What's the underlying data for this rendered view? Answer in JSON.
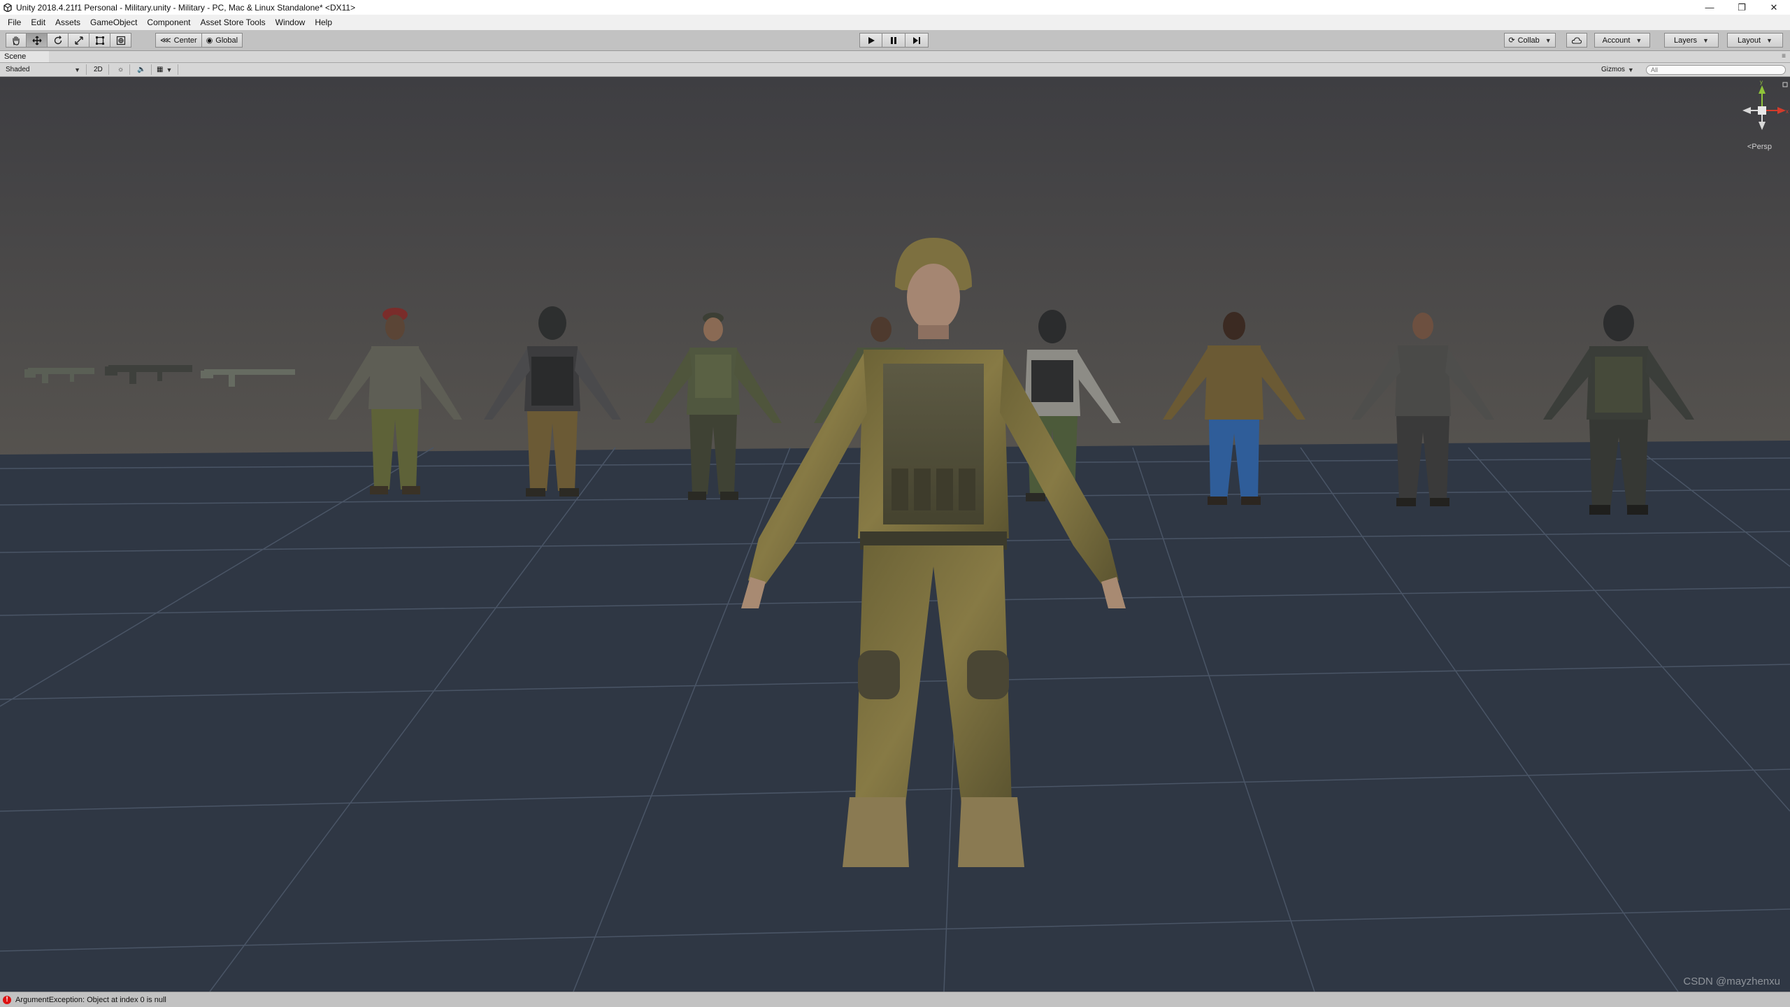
{
  "window": {
    "title": "Unity 2018.4.21f1 Personal - Military.unity - Military - PC, Mac & Linux Standalone* <DX11>",
    "controls": [
      "minimize-icon",
      "restore-icon",
      "close-icon"
    ]
  },
  "menu": {
    "items": [
      "File",
      "Edit",
      "Assets",
      "GameObject",
      "Component",
      "Asset Store Tools",
      "Window",
      "Help"
    ]
  },
  "toolbar": {
    "tools": [
      "hand-tool-icon",
      "move-tool-icon",
      "rotate-tool-icon",
      "scale-tool-icon",
      "rect-tool-icon",
      "transform-tool-icon"
    ],
    "pivot_center": "Center",
    "pivot_global": "Global",
    "play_controls": [
      "play-icon",
      "pause-icon",
      "step-icon"
    ],
    "collab": "Collab",
    "account": "Account",
    "layers": "Layers",
    "layout": "Layout"
  },
  "scene": {
    "tab_label": "Scene",
    "shading_mode": "Shaded",
    "mode_2d": "2D",
    "gizmos": "Gizmos",
    "search_placeholder": "All",
    "projection": "Persp",
    "watermark": "CSDN @mayzhenxu",
    "colors": {
      "skybox": "#3f3f44",
      "ground": "#2f3744",
      "grid_line": "#4a5566",
      "axis_x": "#d33b2b",
      "axis_y": "#8fc43a",
      "axis_z": "#3a7fd4"
    }
  },
  "status": {
    "message": "ArgumentException: Object at index 0 is null",
    "level": "error",
    "color": "#d11111"
  }
}
